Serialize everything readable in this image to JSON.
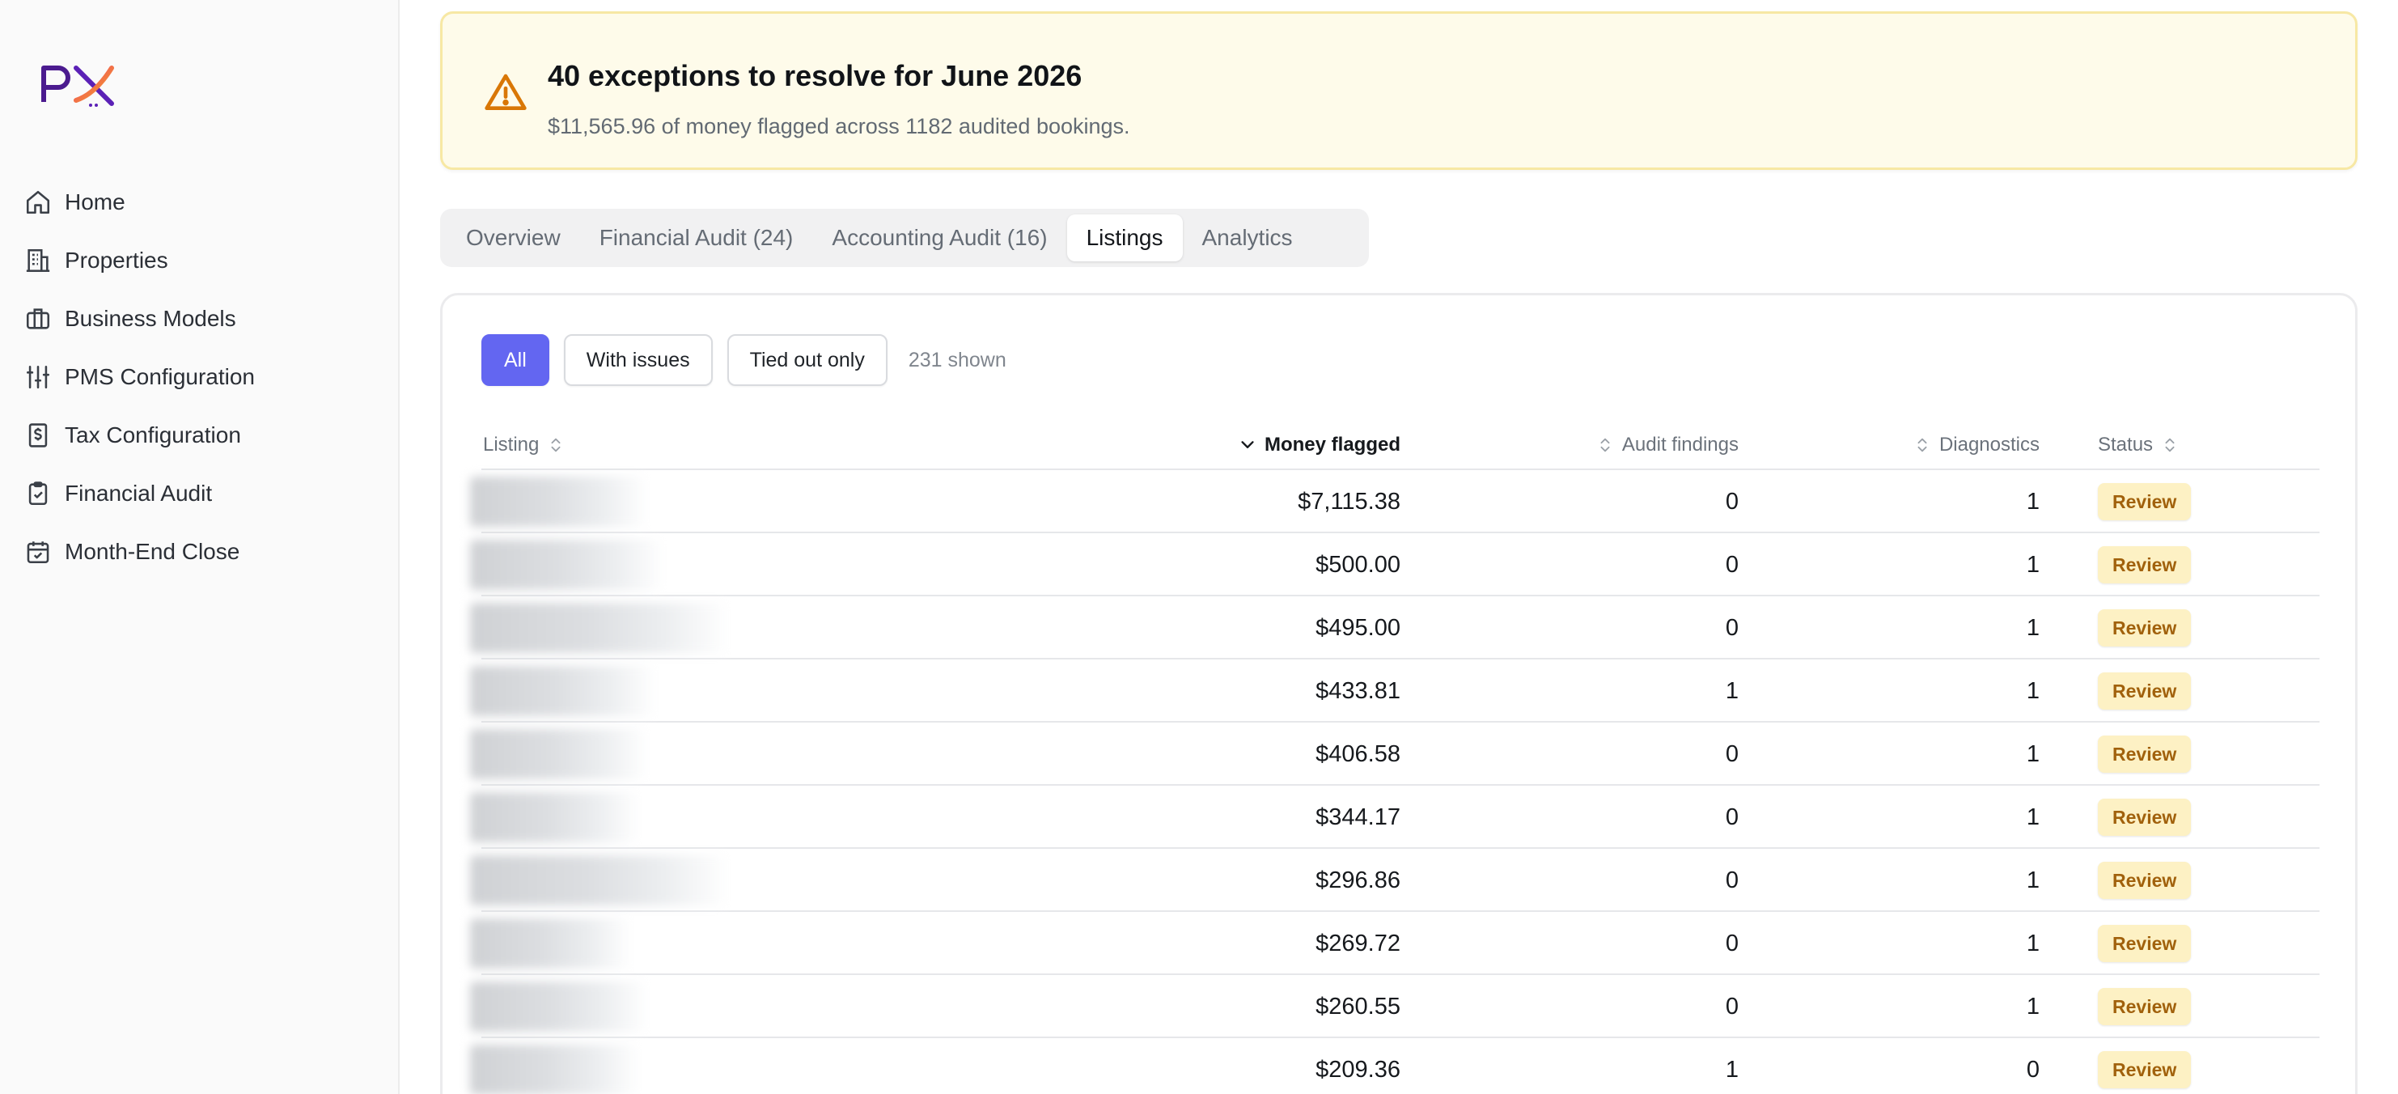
{
  "brand": {
    "logo_text": "PX"
  },
  "sidebar": {
    "items": [
      {
        "label": "Home",
        "icon": "home-icon"
      },
      {
        "label": "Properties",
        "icon": "building-icon"
      },
      {
        "label": "Business Models",
        "icon": "briefcase-icon"
      },
      {
        "label": "PMS Configuration",
        "icon": "sliders-icon"
      },
      {
        "label": "Tax Configuration",
        "icon": "receipt-dollar-icon"
      },
      {
        "label": "Financial Audit",
        "icon": "clipboard-check-icon"
      },
      {
        "label": "Month-End Close",
        "icon": "calendar-check-icon"
      }
    ]
  },
  "banner": {
    "icon": "warning-triangle-icon",
    "title": "40 exceptions to resolve for June 2026",
    "subtitle": "$11,565.96 of money flagged across 1182 audited bookings."
  },
  "tabs": [
    {
      "label": "Overview"
    },
    {
      "label": "Financial Audit (24)"
    },
    {
      "label": "Accounting Audit (16)"
    },
    {
      "label": "Listings"
    },
    {
      "label": "Analytics"
    }
  ],
  "active_tab": "Listings",
  "filters": {
    "buttons": [
      {
        "label": "All"
      },
      {
        "label": "With issues"
      },
      {
        "label": "Tied out only"
      }
    ],
    "active": "All",
    "count_text": "231 shown"
  },
  "table": {
    "columns": {
      "listing": "Listing",
      "money": "Money flagged",
      "audit": "Audit findings",
      "diag": "Diagnostics",
      "status": "Status"
    },
    "sorted_column": "Money flagged",
    "rows": [
      {
        "money": "$7,115.38",
        "audit": "0",
        "diag": "1",
        "status": "Review"
      },
      {
        "money": "$500.00",
        "audit": "0",
        "diag": "1",
        "status": "Review"
      },
      {
        "money": "$495.00",
        "audit": "0",
        "diag": "1",
        "status": "Review"
      },
      {
        "money": "$433.81",
        "audit": "1",
        "diag": "1",
        "status": "Review"
      },
      {
        "money": "$406.58",
        "audit": "0",
        "diag": "1",
        "status": "Review"
      },
      {
        "money": "$344.17",
        "audit": "0",
        "diag": "1",
        "status": "Review"
      },
      {
        "money": "$296.86",
        "audit": "0",
        "diag": "1",
        "status": "Review"
      },
      {
        "money": "$269.72",
        "audit": "0",
        "diag": "1",
        "status": "Review"
      },
      {
        "money": "$260.55",
        "audit": "0",
        "diag": "1",
        "status": "Review"
      },
      {
        "money": "$209.36",
        "audit": "1",
        "diag": "0",
        "status": "Review"
      }
    ]
  },
  "colors": {
    "accent": "#6366f1",
    "warning": "#d97706",
    "banner_bg": "#fefbea",
    "badge_bg": "#fdf1c4",
    "badge_text": "#a1610c"
  }
}
